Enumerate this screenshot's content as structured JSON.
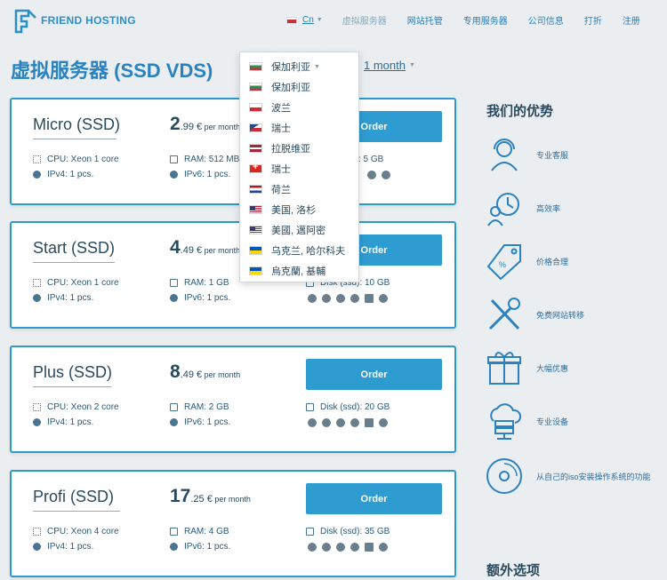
{
  "brand": {
    "name": "FRIEND HOSTING"
  },
  "nav": {
    "lang": "Cn",
    "items": [
      "虚拟服务器",
      "网站托管",
      "专用服务器",
      "公司信息",
      "打折",
      "注册"
    ]
  },
  "page": {
    "title": "虚拟服务器 (SSD VDS)",
    "period": "1 month"
  },
  "dropdown": {
    "selected": "保加利亚",
    "items": [
      {
        "flag": "bg",
        "label": "保加利亚"
      },
      {
        "flag": "pl",
        "label": "波兰"
      },
      {
        "flag": "cz",
        "label": "瑞士"
      },
      {
        "flag": "lv",
        "label": "拉脱维亚"
      },
      {
        "flag": "ch",
        "label": "瑞士"
      },
      {
        "flag": "nl",
        "label": "荷兰"
      },
      {
        "flag": "us",
        "label": "美国, 洛杉"
      },
      {
        "flag": "us",
        "label": "美國, 邁阿密"
      },
      {
        "flag": "ua",
        "label": "乌克兰, 哈尔科夫"
      },
      {
        "flag": "ua",
        "label": "烏克蘭, 基輔"
      }
    ]
  },
  "plans": [
    {
      "name": "Micro (SSD)",
      "price_int": "2",
      "price_dec": ".99 €",
      "per": " per month",
      "order": "Order",
      "cpu": "CPU: Xeon 1 core",
      "ipv4": "IPv4: 1 pcs.",
      "ram": "RAM: 512 MB",
      "ipv6": "IPv6: 1 pcs.",
      "disk": ": 5 GB"
    },
    {
      "name": "Start (SSD)",
      "price_int": "4",
      "price_dec": ".49 €",
      "per": " per month",
      "order": "Order",
      "cpu": "CPU: Xeon 1 core",
      "ipv4": "IPv4: 1 pcs.",
      "ram": "RAM: 1 GB",
      "ipv6": "IPv6: 1 pcs.",
      "disk": "Disk (ssd): 10 GB"
    },
    {
      "name": "Plus (SSD)",
      "price_int": "8",
      "price_dec": ".49 €",
      "per": " per month",
      "order": "Order",
      "cpu": "CPU: Xeon 2 core",
      "ipv4": "IPv4: 1 pcs.",
      "ram": "RAM: 2 GB",
      "ipv6": "IPv6: 1 pcs.",
      "disk": "Disk (ssd): 20 GB"
    },
    {
      "name": "Profi (SSD)",
      "price_int": "17",
      "price_dec": ".25 €",
      "per": " per month",
      "order": "Order",
      "cpu": "CPU: Xeon 4 core",
      "ipv4": "IPv4: 1 pcs.",
      "ram": "RAM: 4 GB",
      "ipv6": "IPv6: 1 pcs.",
      "disk": "Disk (ssd): 35 GB"
    }
  ],
  "sidebar": {
    "advantages_title": "我们的优势",
    "features": [
      "专业客服",
      "高效率",
      "价格合理",
      "免费网站转移",
      "大幅优惠",
      "专业设备",
      "从自己的iso安装操作系统的功能"
    ],
    "extras_title": "额外选项"
  },
  "colors": {
    "accent": "#2e9bd1",
    "text": "#2a4a5e",
    "bg": "#ebeef1"
  }
}
